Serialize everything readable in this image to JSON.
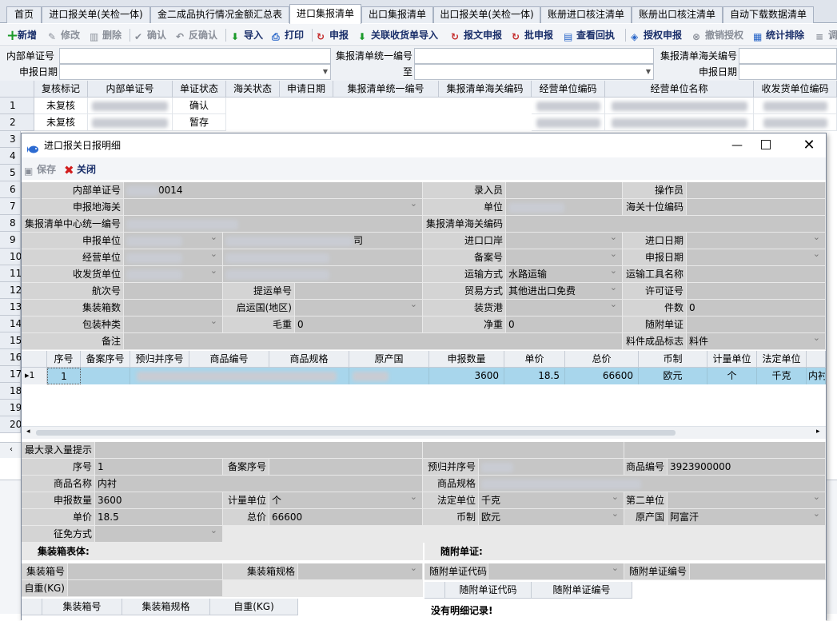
{
  "tabs": [
    "首页",
    "进口报关单(关检一体)",
    "金二成品执行情况金额汇总表",
    "进口集报清单",
    "出口集报清单",
    "出口报关单(关检一体)",
    "账册进口核注清单",
    "账册出口核注清单",
    "自动下载数据清单"
  ],
  "toolbar": {
    "add": "新增",
    "edit": "修改",
    "delete": "删除",
    "confirm": "确认",
    "unconfirm": "反确认",
    "import": "导入",
    "print": "打印",
    "declare": "申报",
    "link_import": "关联收货单导入",
    "msg_declare": "报文申报",
    "batch_declare": "批申报",
    "view_receipt": "查看回执",
    "auth_declare": "授权申报",
    "revoke_auth": "撤销授权",
    "stats_sort": "统计排除",
    "more": "调"
  },
  "search": {
    "internal_no_label": "内部单证号",
    "unified_no_label": "集报清单统一编号",
    "customs_no_label": "集报清单海关编号",
    "date_label": "申报日期",
    "to_label": "至",
    "declare_date_label": "申报日期"
  },
  "grid": {
    "headers": [
      "复核标记",
      "内部单证号",
      "单证状态",
      "海关状态",
      "申请日期",
      "集报清单统一编号",
      "集报清单海关编码",
      "经营单位编码",
      "经营单位名称",
      "收发货单位编码"
    ],
    "rows": [
      {
        "n": "1",
        "review": "未复核",
        "status": "确认"
      },
      {
        "n": "2",
        "review": "未复核",
        "status": "暂存"
      }
    ],
    "row_numbers": [
      "3",
      "4",
      "5",
      "6",
      "7",
      "8",
      "9",
      "10",
      "11",
      "12",
      "13",
      "14",
      "15",
      "16",
      "17",
      "18",
      "19",
      "20"
    ]
  },
  "dialog": {
    "title": "进口报关日报明细",
    "save": "保存",
    "close": "关闭",
    "form": {
      "internal_no_label": "内部单证号",
      "internal_no_value": "0014",
      "declare_customs_label": "申报地海关",
      "center_no_label": "集报清单中心统一编号",
      "declare_unit_label": "申报单位",
      "company_suffix": "司",
      "operator_unit_label": "经营单位",
      "consignee_label": "收发货单位",
      "voyage_label": "航次号",
      "bl_label": "提运单号",
      "container_count_label": "集装箱数",
      "origin_label": "启运国(地区)",
      "pack_type_label": "包装种类",
      "gross_label": "毛重",
      "gross_value": "0",
      "remark_label": "备注",
      "entry_label": "录入员",
      "unit_label": "单位",
      "customs_no_label": "集报清单海关编码",
      "port_label": "进口口岸",
      "record_no_label": "备案号",
      "transport_label": "运输方式",
      "transport_value": "水路运输",
      "trade_label": "贸易方式",
      "trade_value": "其他进出口免费",
      "load_port_label": "装货港",
      "net_label": "净重",
      "net_value": "0",
      "operator_label": "操作员",
      "hs10_label": "海关十位编码",
      "import_date_label": "进口日期",
      "declare_date_label": "申报日期",
      "tool_label": "运输工具名称",
      "license_label": "许可证号",
      "pieces_label": "件数",
      "pieces_value": "0",
      "attach_label": "随附单证",
      "material_flag_label": "料件成品标志",
      "material_flag_value": "料件"
    },
    "items": {
      "headers": [
        "序号",
        "备案序号",
        "预归并序号",
        "商品编号",
        "商品规格",
        "原产国",
        "申报数量",
        "单价",
        "总价",
        "币制",
        "计量单位",
        "法定单位"
      ],
      "row": {
        "seq": "1",
        "qty": "3600",
        "price": "18.5",
        "total": "66600",
        "currency": "欧元",
        "unit": "个",
        "legal_unit": "千克",
        "extra": "内衬"
      }
    },
    "detail": {
      "max_hint_label": "最大录入量提示",
      "seq_label": "序号",
      "seq_value": "1",
      "record_seq_label": "备案序号",
      "pre_seq_label": "预归并序号",
      "goods_no_label": "商品编号",
      "goods_no_value": "3923900000",
      "goods_name_label": "商品名称",
      "goods_name_value": "内衬",
      "goods_spec_label": "商品规格",
      "qty_label": "申报数量",
      "qty_value": "3600",
      "unit_label": "计量单位",
      "unit_value": "个",
      "legal_unit_label": "法定单位",
      "legal_unit_value": "千克",
      "second_unit_label": "第二单位",
      "price_label": "单价",
      "price_value": "18.5",
      "total_label": "总价",
      "total_value": "66600",
      "currency_label": "币制",
      "currency_value": "欧元",
      "origin_label": "原产国",
      "origin_value": "阿富汗",
      "exempt_label": "征免方式"
    },
    "container": {
      "title": "集装箱表体:",
      "no_label": "集装箱号",
      "spec_label": "集装箱规格",
      "weight_label": "自重(KG)",
      "headers": [
        "集装箱号",
        "集装箱规格",
        "自重(KG)"
      ]
    },
    "attach": {
      "title": "随附单证:",
      "code_label": "随附单证代码",
      "no_label": "随附单证编号",
      "headers": [
        "随附单证代码",
        "随附单证编号"
      ],
      "empty": "没有明细记录!"
    }
  },
  "colors": {
    "accent": "#1f5fbf",
    "selected_row": "#a8d6ec",
    "label_bg": "#d4d4d4",
    "value_bg": "#c6c6c6"
  }
}
